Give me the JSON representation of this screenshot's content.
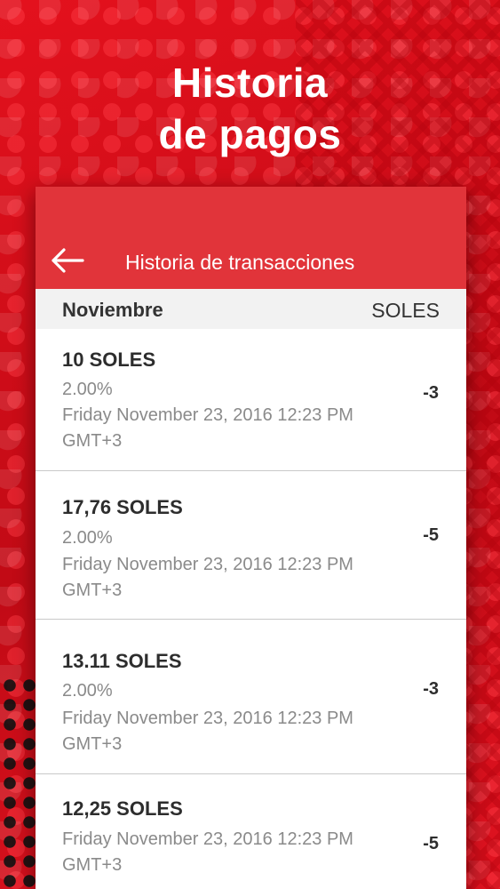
{
  "hero": {
    "line1": "Historia",
    "line2": "de pagos"
  },
  "appbar": {
    "title": "Historia de transacciones",
    "back_icon": "arrow-left-icon"
  },
  "section": {
    "month": "Noviembre",
    "currency": "SOLES"
  },
  "transactions": [
    {
      "amount": "10 SOLES",
      "rate": "2.00%",
      "date": "Friday November 23, 2016 12:23 PM GMT+3",
      "value": "-3"
    },
    {
      "amount": "17,76 SOLES",
      "rate": "2.00%",
      "date": "Friday November 23, 2016 12:23 PM GMT+3",
      "value": "-5"
    },
    {
      "amount": "13.11 SOLES",
      "rate": "2.00%",
      "date": "Friday November 23, 2016 12:23 PM GMT+3",
      "value": "-3"
    },
    {
      "amount": "12,25 SOLES",
      "date": "Friday November 23, 2016 12:23 PM GMT+3",
      "value": "-5"
    }
  ],
  "colors": {
    "brand_red": "#d9111c",
    "appbar_red": "#e1343a"
  }
}
